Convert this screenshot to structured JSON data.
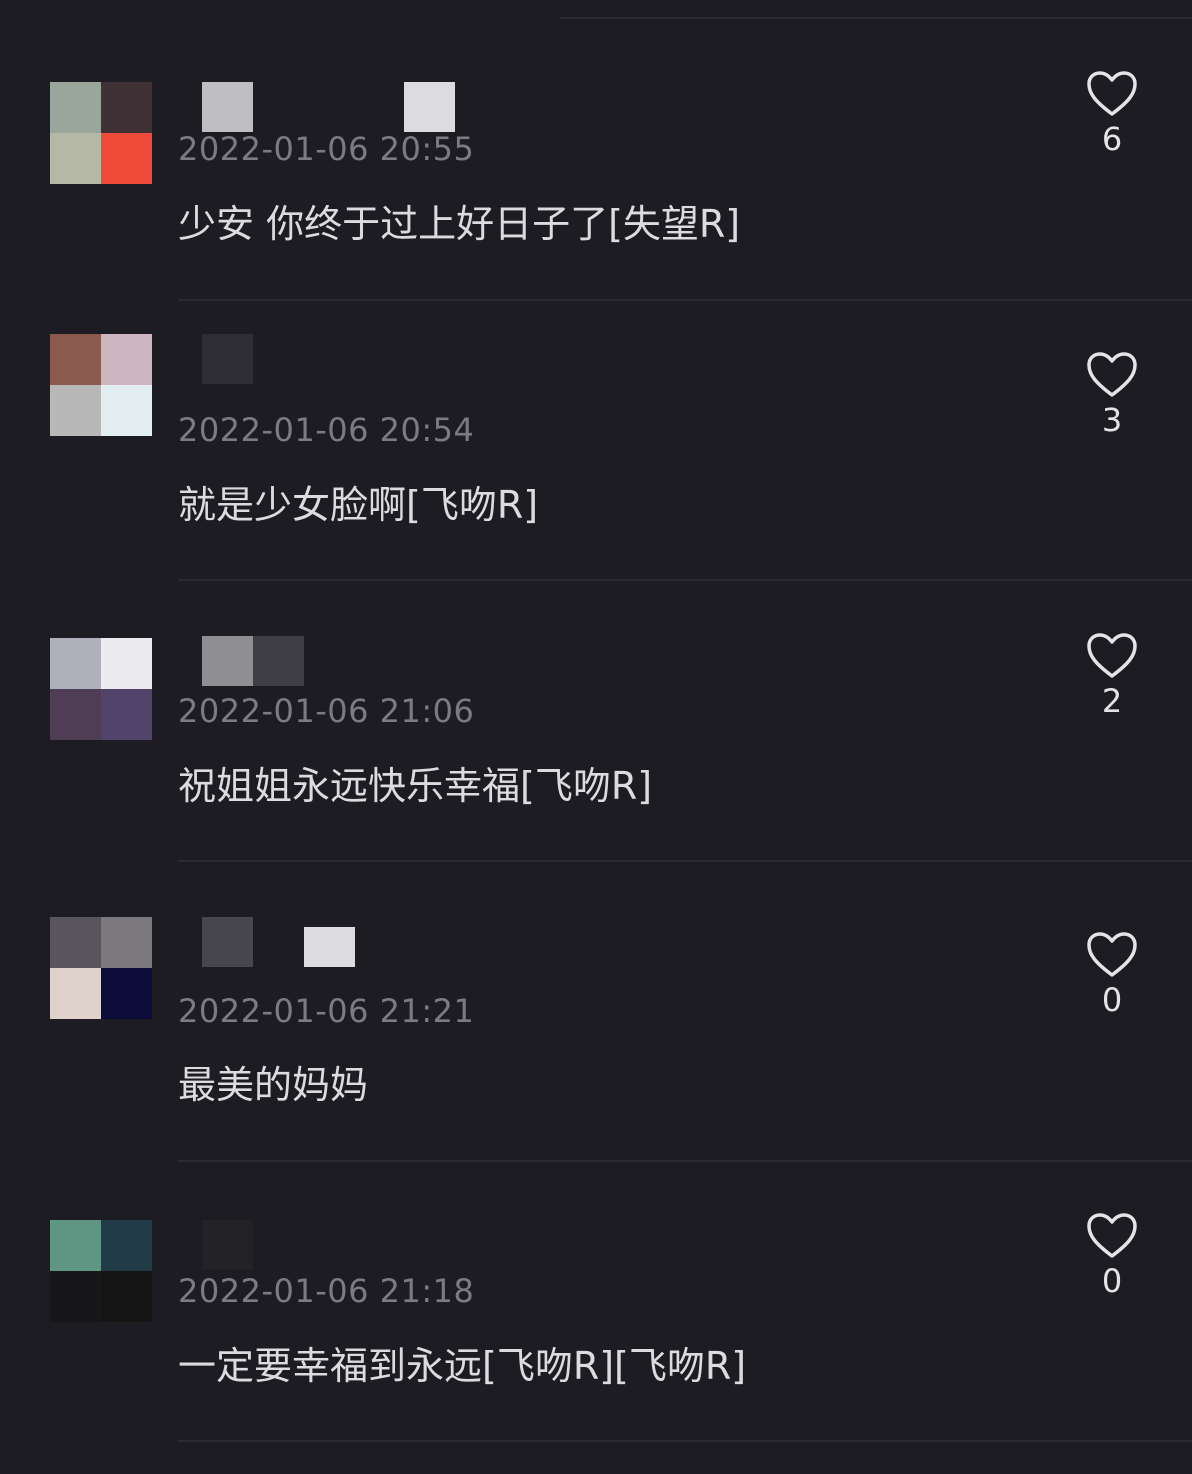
{
  "comments": [
    {
      "timestamp": "2022-01-06 20:55",
      "text": "少安 你终于过上好日子了[失望R]",
      "likes": "6",
      "avatar_colors": [
        "#9aa59c",
        "#3f3136",
        "#b5b8a5",
        "#f04a3a"
      ],
      "name_blur_colors": [
        "#bfbfc2",
        "#dcdcde"
      ]
    },
    {
      "timestamp": "2022-01-06 20:54",
      "text": "就是少女脸啊[飞吻R]",
      "likes": "3",
      "avatar_colors": [
        "#8a5a4e",
        "#cdb6bf",
        "#b8b8b9",
        "#e2eef0"
      ],
      "name_blur_colors": [
        "#2d2d33"
      ]
    },
    {
      "timestamp": "2022-01-06 21:06",
      "text": "祝姐姐永远快乐幸福[飞吻R]",
      "likes": "2",
      "avatar_colors": [
        "#aeb0bb",
        "#ececee",
        "#4e3d55",
        "#52436a"
      ],
      "name_blur_colors": [
        "#8f8f93",
        "#3e3e44"
      ]
    },
    {
      "timestamp": "2022-01-06 21:21",
      "text": "最美的妈妈",
      "likes": "0",
      "avatar_colors": [
        "#58565c",
        "#7a787d",
        "#dfd2cd",
        "#0c0b3a"
      ],
      "name_blur_colors": [
        "#47464c",
        "#dcdcde"
      ]
    },
    {
      "timestamp": "2022-01-06 21:18",
      "text": "一定要幸福到永远[飞吻R][飞吻R]",
      "likes": "0",
      "avatar_colors": [
        "#5e9683",
        "#213c46",
        "#17171a",
        "#141414"
      ],
      "name_blur_colors": [
        "#232327"
      ]
    }
  ],
  "icons": {
    "like": "heart-outline-icon"
  }
}
